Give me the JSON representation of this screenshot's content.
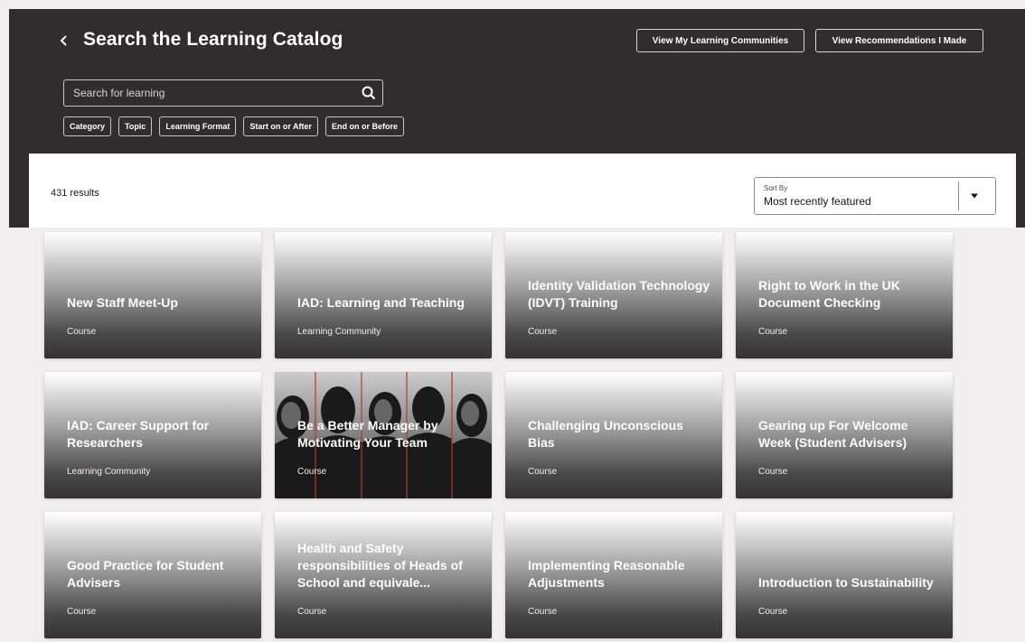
{
  "header": {
    "title": "Search the Learning Catalog",
    "btn_communities": "View My Learning Communities",
    "btn_recommendations": "View Recommendations I Made"
  },
  "search": {
    "placeholder": "Search for learning",
    "value": ""
  },
  "filters": [
    "Category",
    "Topic",
    "Learning Format",
    "Start on or After",
    "End on or Before"
  ],
  "results": {
    "count": "431 results",
    "sort_label": "Sort By",
    "sort_value": "Most recently featured"
  },
  "cards": [
    {
      "title": "New Staff Meet-Up",
      "type": "Course"
    },
    {
      "title": "IAD: Learning and Teaching",
      "type": "Learning Community"
    },
    {
      "title": "Identity Validation Technology (IDVT) Training",
      "type": "Course"
    },
    {
      "title": "Right to Work in the UK Document Checking",
      "type": "Course"
    },
    {
      "title": "IAD: Career Support for Researchers",
      "type": "Learning Community"
    },
    {
      "title": "Be a Better Manager by Motivating Your Team",
      "type": "Course"
    },
    {
      "title": "Challenging Unconscious Bias",
      "type": "Course"
    },
    {
      "title": "Gearing up For Welcome Week (Student Advisers)",
      "type": "Course"
    },
    {
      "title": "Good Practice for Student Advisers",
      "type": "Course"
    },
    {
      "title": "Health and Safety responsibilities of Heads of School and equivale...",
      "type": "Course"
    },
    {
      "title": "Implementing Reasonable Adjustments",
      "type": "Course"
    },
    {
      "title": "Introduction to Sustainability",
      "type": "Course"
    }
  ],
  "colors": {
    "header_bg": "#312d2a",
    "page_bg": "#f1efed",
    "photo_accent": "#c74634"
  },
  "icons": {
    "back": "chevron-left-icon",
    "search": "search-icon",
    "sort": "caret-down-icon"
  }
}
